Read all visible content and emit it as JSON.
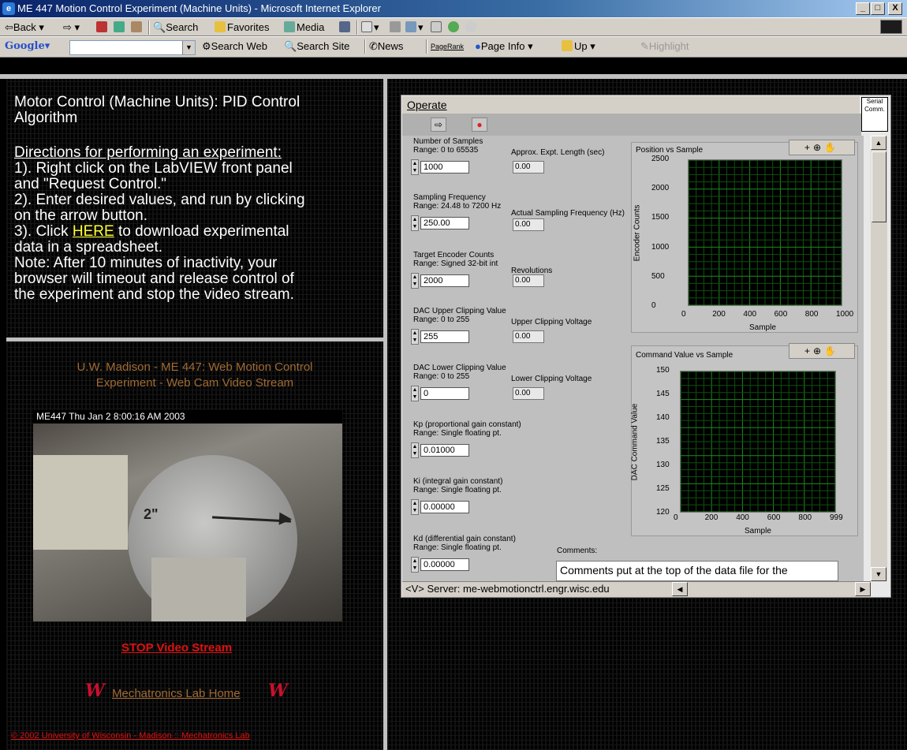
{
  "window": {
    "title": "ME 447 Motion Control Experiment (Machine Units) - Microsoft Internet Explorer",
    "minimize": "_",
    "maximize": "□",
    "close": "X"
  },
  "toolbar": {
    "back": "Back",
    "search": "Search",
    "favorites": "Favorites",
    "media": "Media"
  },
  "googlebar": {
    "brand": "Google",
    "search_web": "Search Web",
    "search_site": "Search Site",
    "news": "News",
    "pagerank": "PageRank",
    "page_info": "Page Info",
    "up": "Up",
    "highlight": "Highlight"
  },
  "instructions": {
    "title_line1": "Motor Control (Machine Units): PID Control",
    "title_line2": "Algorithm",
    "directions_header": "Directions for performing an experiment:",
    "step1_line1": "1). Right click on the LabVIEW front panel",
    "step1_line2": "and \"Request Control.\"",
    "step2_line1": "2). Enter desired values, and run by clicking",
    "step2_line2": "on the arrow button.",
    "step3_prefix": "3). Click ",
    "step3_link": "HERE",
    "step3_suffix": " to download experimental",
    "step3_line2": "data in a spreadsheet.",
    "note_line1": "Note: After 10 minutes of inactivity, your",
    "note_line2": "browser will timeout and release control of",
    "note_line3": "the experiment and stop the video stream."
  },
  "webcam": {
    "title_line1": "U.W. Madison - ME 447:  Web Motion Control",
    "title_line2": "Experiment - Web Cam Video Stream",
    "overlay": "ME447  Thu Jan  2   8:00:16 AM  2003",
    "disk_label": "2\"",
    "stop_link": "STOP Video Stream",
    "home_link": "Mechatronics Lab Home",
    "footer_link": "© 2002 University of Wisconsin - Madison :: Mechatronics Lab"
  },
  "labview": {
    "menu": "Operate",
    "serial_icon": "Serial Comm.",
    "controls": [
      {
        "label": "Number of Samples",
        "range": "Range: 0 to 65535",
        "value": "1000",
        "ind_label": "Approx. Expt. Length (sec)",
        "ind_value": "0.00"
      },
      {
        "label": "Sampling Frequency",
        "range": "Range: 24.48 to 7200 Hz",
        "value": "250.00",
        "ind_label": "Actual Sampling Frequency (Hz)",
        "ind_value": "0.00"
      },
      {
        "label": "Target Encoder Counts",
        "range": "Range: Signed 32-bit int",
        "value": "2000",
        "ind_label": "Revolutions",
        "ind_value": "0.00"
      },
      {
        "label": "DAC Upper Clipping Value",
        "range": "Range: 0 to 255",
        "value": "255",
        "ind_label": "Upper Clipping Voltage",
        "ind_value": "0.00"
      },
      {
        "label": "DAC Lower Clipping Value",
        "range": "Range: 0 to 255",
        "value": "0",
        "ind_label": "Lower Clipping Voltage",
        "ind_value": "0.00"
      },
      {
        "label": "Kp (proportional gain constant)",
        "range": "Range: Single floating pt.",
        "value": "0.01000"
      },
      {
        "label": "Ki (integral gain constant)",
        "range": "Range: Single floating pt.",
        "value": "0.00000"
      },
      {
        "label": "Kd (differential gain constant)",
        "range": "Range: Single floating pt.",
        "value": "0.00000"
      }
    ],
    "comments_label": "Comments:",
    "comments_value": "Comments put at the top of the data file for the",
    "status": "<V> Server: me-webmotionctrl.engr.wisc.edu"
  },
  "chart_data": [
    {
      "type": "line",
      "title": "Position vs Sample",
      "xlabel": "Sample",
      "ylabel": "Encoder Counts",
      "xlim": [
        0,
        1000
      ],
      "ylim": [
        0,
        2500
      ],
      "xticks": [
        "0",
        "200",
        "400",
        "600",
        "800",
        "1000"
      ],
      "yticks": [
        "0",
        "500",
        "1000",
        "1500",
        "2000",
        "2500"
      ],
      "grid": true,
      "series": []
    },
    {
      "type": "line",
      "title": "Command Value vs Sample",
      "xlabel": "Sample",
      "ylabel": "DAC Command Value",
      "xlim": [
        0,
        999
      ],
      "ylim": [
        120,
        150
      ],
      "xticks": [
        "0",
        "200",
        "400",
        "600",
        "800",
        "999"
      ],
      "yticks": [
        "120",
        "125",
        "130",
        "135",
        "140",
        "145",
        "150"
      ],
      "grid": true,
      "series": []
    }
  ]
}
